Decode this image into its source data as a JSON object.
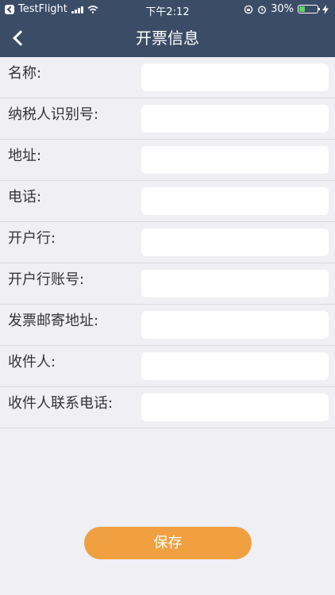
{
  "status_bar": {
    "carrier": "TestFlight",
    "time": "下午2:12",
    "battery": "30%"
  },
  "nav": {
    "title": "开票信息",
    "back_icon": "chevron-left-icon"
  },
  "form": {
    "fields": [
      {
        "label": "名称:",
        "value": "",
        "placeholder": ""
      },
      {
        "label": "纳税人识别号:",
        "value": "",
        "placeholder": ""
      },
      {
        "label": "地址:",
        "value": "",
        "placeholder": ""
      },
      {
        "label": "电话:",
        "value": "",
        "placeholder": ""
      },
      {
        "label": "开户行:",
        "value": "",
        "placeholder": ""
      },
      {
        "label": "开户行账号:",
        "value": "",
        "placeholder": ""
      },
      {
        "label": "发票邮寄地址:",
        "value": "",
        "placeholder": ""
      },
      {
        "label": "收件人:",
        "value": "",
        "placeholder": ""
      },
      {
        "label": "收件人联系电话:",
        "value": "",
        "placeholder": ""
      }
    ]
  },
  "actions": {
    "save_label": "保存"
  },
  "colors": {
    "header_bg": "#3b4c66",
    "page_bg": "#efeff4",
    "button_bg": "#f0a040"
  }
}
